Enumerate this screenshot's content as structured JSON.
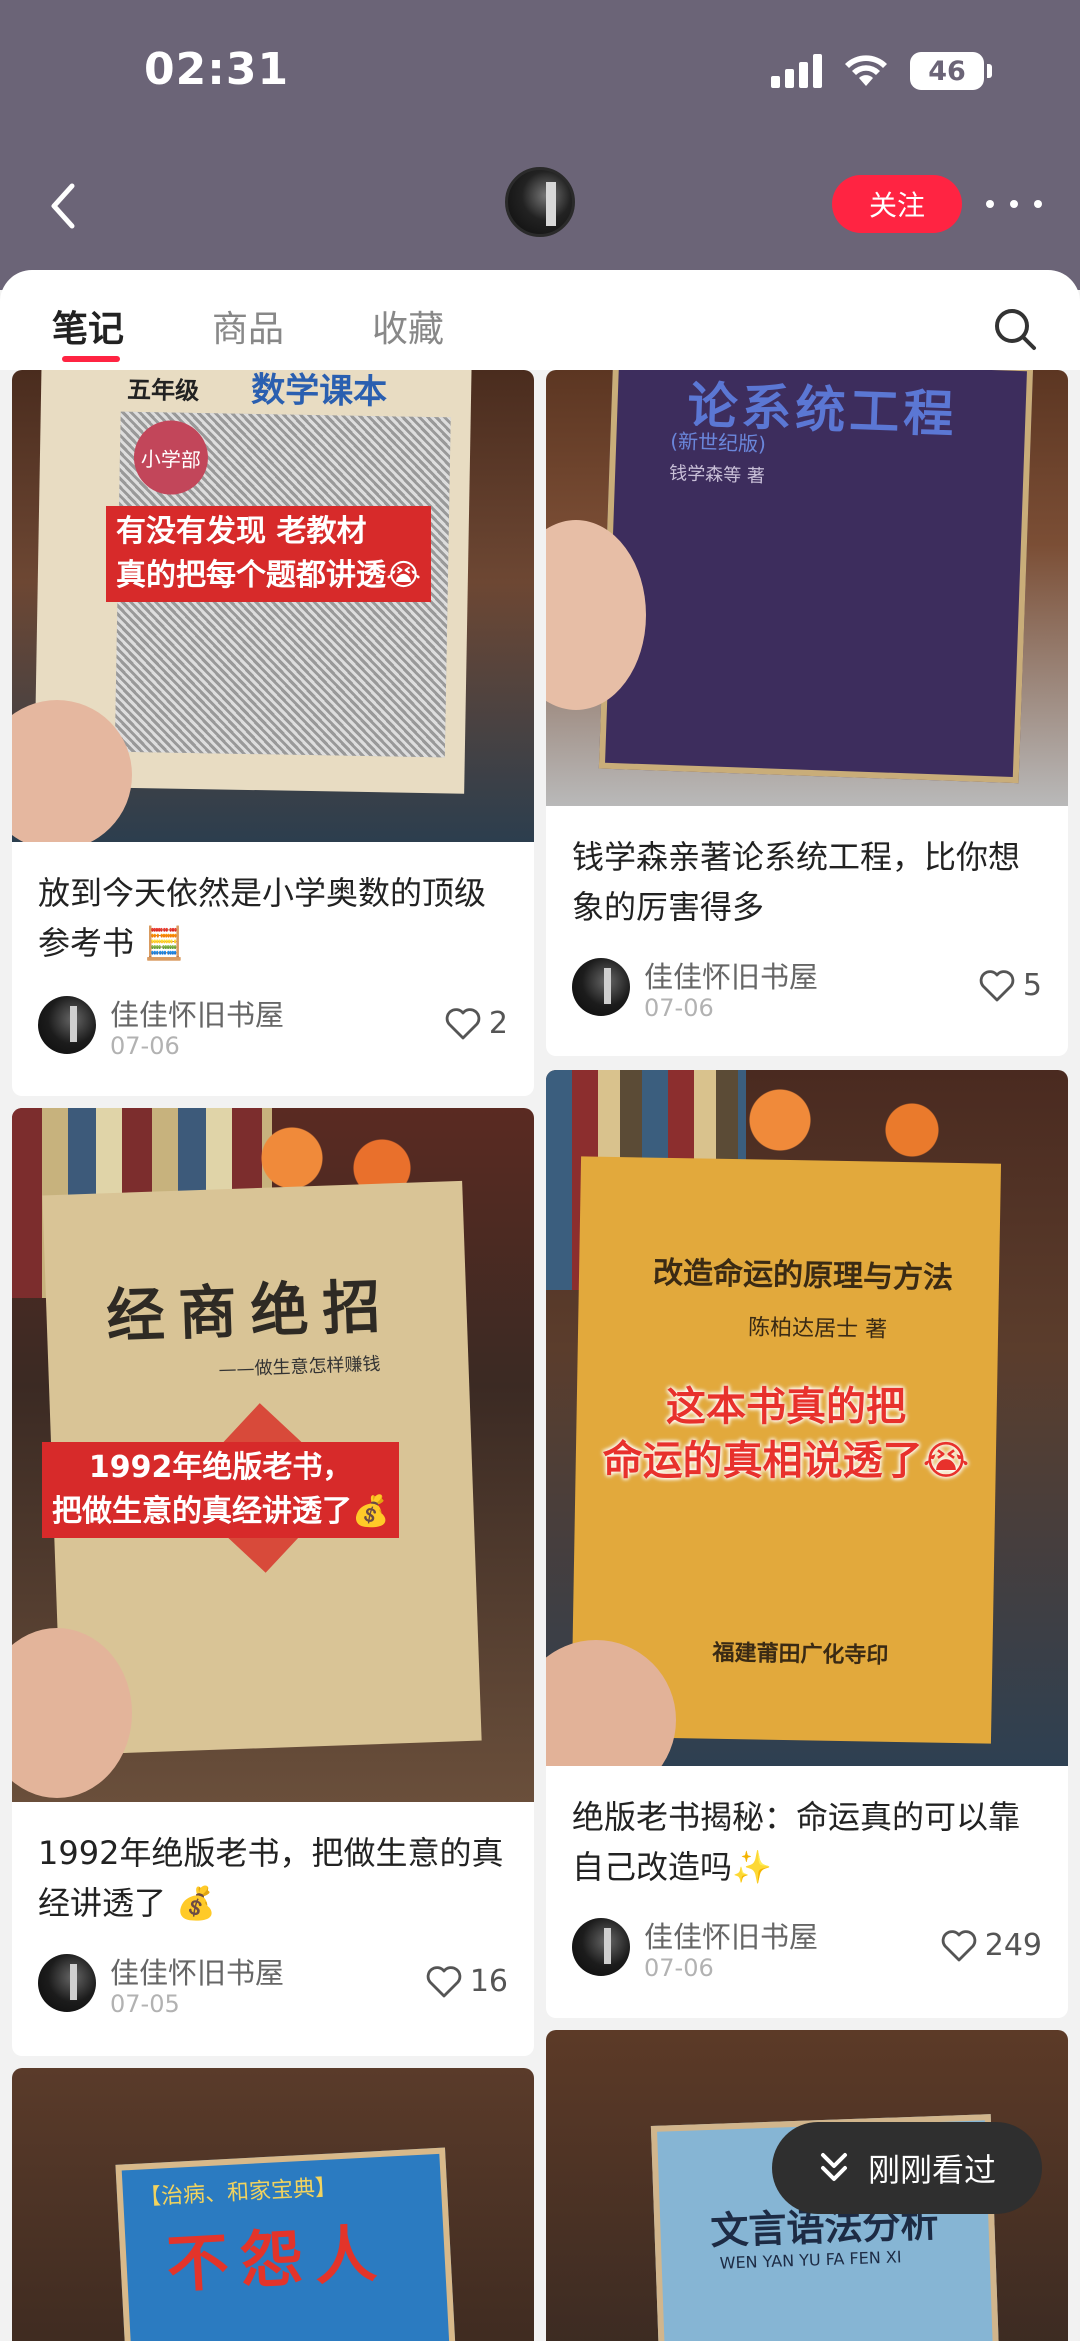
{
  "status": {
    "time": "02:31",
    "battery": "46"
  },
  "header": {
    "follow_label": "关注"
  },
  "tabs": [
    {
      "label": "笔记",
      "active": true
    },
    {
      "label": "商品",
      "active": false
    },
    {
      "label": "收藏",
      "active": false
    }
  ],
  "posts": [
    {
      "cover_text": {
        "book_title": "数学课本",
        "grade": "五年级",
        "seal": "小学部",
        "banner": "有没有发现 老教材\n真的把每个题都讲透😭"
      },
      "title": "放到今天依然是小学奥数的顶级参考书 🧮",
      "author": "佳佳怀旧书屋",
      "date": "07-06",
      "likes": "2"
    },
    {
      "cover_text": {
        "book_title": "论系统工程",
        "edition": "(新世纪版)",
        "author_line": "钱学森等  著"
      },
      "title": "钱学森亲著论系统工程，比你想象的厉害得多",
      "author": "佳佳怀旧书屋",
      "date": "07-06",
      "likes": "5"
    },
    {
      "cover_text": {
        "book_title": "经商绝招",
        "subtitle": "——做生意怎样赚钱",
        "banner": "1992年绝版老书，\n把做生意的真经讲透了💰"
      },
      "title": "1992年绝版老书，把做生意的真经讲透了 💰",
      "author": "佳佳怀旧书屋",
      "date": "07-05",
      "likes": "16"
    },
    {
      "cover_text": {
        "book_title": "改造命运的原理与方法",
        "author_line": "陈柏达居士  著",
        "banner": "这本书真的把\n命运的真相说透了😭",
        "publisher": "福建莆田广化寺印"
      },
      "title": "绝版老书揭秘：命运真的可以靠自己改造吗✨",
      "author": "佳佳怀旧书屋",
      "date": "07-06",
      "likes": "249"
    },
    {
      "cover_text": {
        "book_title": "不怨人",
        "top_line": "【治病、和家宝典】"
      }
    },
    {
      "cover_text": {
        "book_title": "文言语法分析",
        "pinyin": "WEN YAN YU FA FEN XI"
      }
    }
  ],
  "recent_button": {
    "label": "刚刚看过"
  },
  "colors": {
    "accent": "#ff2442",
    "header_bg": "#6b6477"
  },
  "icons": [
    "back-icon",
    "more-icon",
    "search-icon",
    "heart-icon",
    "double-chevron-down-icon"
  ]
}
